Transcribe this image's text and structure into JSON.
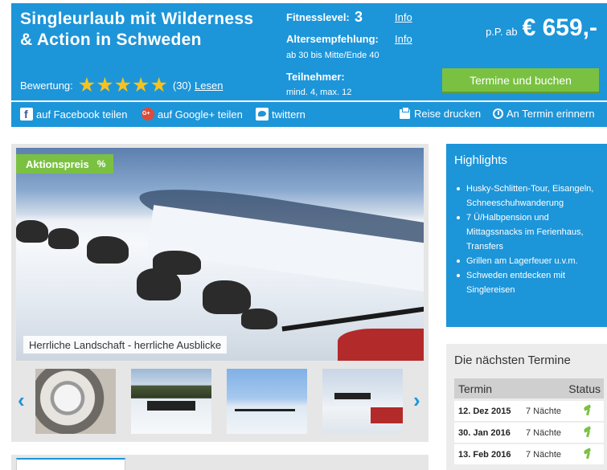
{
  "header": {
    "title": "Singleurlaub mit Wilderness & Action in Schweden",
    "rating_label": "Bewertung:",
    "stars": 5,
    "rating_count": "(30)",
    "read_label": "Lesen",
    "fitness_label": "Fitnesslevel:",
    "fitness_value": "3",
    "fitness_info": "Info",
    "age_label": "Altersempfehlung:",
    "age_info": "Info",
    "age_value": "ab 30 bis Mitte/Ende 40",
    "participants_label": "Teilnehmer:",
    "participants_value": "mind. 4, max. 12",
    "price_prefix": "p.P. ab",
    "price": "€ 659,-",
    "book_button": "Termine und buchen"
  },
  "share": {
    "facebook": "auf Facebook teilen",
    "google": "auf Google+ teilen",
    "twitter": "twittern",
    "print": "Reise drucken",
    "remind": "An Termin erinnern"
  },
  "gallery": {
    "badge": "Aktionspreis",
    "badge_symbol": "%",
    "caption": "Herrliche Landschaft - herrliche Ausblicke",
    "prev": "‹",
    "next": "›"
  },
  "highlights": {
    "title": "Highlights",
    "items": [
      "Husky-Schlitten-Tour, Eisangeln, Schneeschuhwanderung",
      "7 Ü/Halbpension und Mittagssnacks im Ferienhaus, Transfers",
      "Grillen am Lagerfeuer u.v.m.",
      "Schweden entdecken mit Singlereisen"
    ]
  },
  "termine": {
    "title": "Die nächsten Termine",
    "col_termin": "Termin",
    "col_status": "Status",
    "rows": [
      {
        "date": "12. Dez 2015",
        "nights": "7 Nächte"
      },
      {
        "date": "30. Jan 2016",
        "nights": "7 Nächte"
      },
      {
        "date": "13. Feb 2016",
        "nights": "7 Nächte"
      }
    ]
  },
  "colors": {
    "brand_blue": "#1d95d9",
    "accent_green": "#7ac142",
    "star_yellow": "#f7c21b"
  }
}
